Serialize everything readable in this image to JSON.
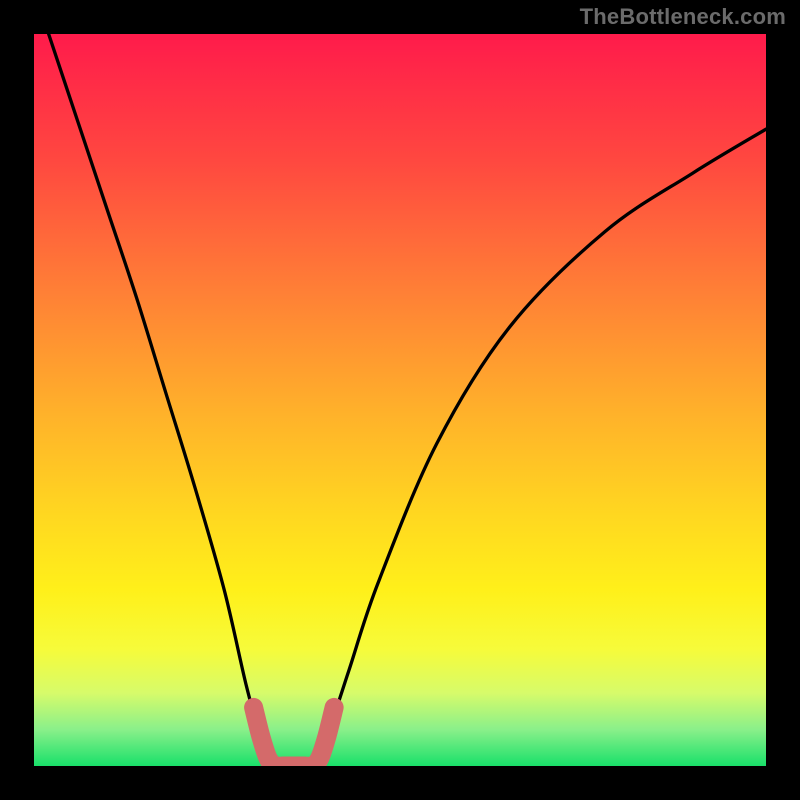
{
  "watermark": "TheBottleneck.com",
  "chart_data": {
    "type": "line",
    "title": "",
    "xlabel": "",
    "ylabel": "",
    "xlim": [
      0,
      100
    ],
    "ylim": [
      0,
      100
    ],
    "series": [
      {
        "name": "curve-left",
        "x": [
          2,
          6,
          10,
          14,
          18,
          22,
          26,
          29,
          31,
          33
        ],
        "y": [
          100,
          88,
          76,
          64,
          51,
          38,
          24,
          11,
          4,
          0
        ]
      },
      {
        "name": "curve-right",
        "x": [
          38,
          40,
          43,
          47,
          55,
          65,
          78,
          90,
          100
        ],
        "y": [
          0,
          4,
          13,
          25,
          44,
          60,
          73,
          81,
          87
        ]
      },
      {
        "name": "valley-marker",
        "x": [
          30,
          31,
          32,
          33,
          34,
          35,
          36,
          37,
          38,
          39,
          40,
          41
        ],
        "y": [
          8,
          4,
          1,
          0,
          0,
          0,
          0,
          0,
          0,
          1,
          4,
          8
        ]
      }
    ],
    "background": {
      "type": "vertical-gradient",
      "stops": [
        {
          "offset": 0.0,
          "color": "#ff1b4b"
        },
        {
          "offset": 0.17,
          "color": "#ff4740"
        },
        {
          "offset": 0.35,
          "color": "#ff7f36"
        },
        {
          "offset": 0.52,
          "color": "#ffb22a"
        },
        {
          "offset": 0.66,
          "color": "#ffd820"
        },
        {
          "offset": 0.76,
          "color": "#fff01a"
        },
        {
          "offset": 0.84,
          "color": "#f6fb3a"
        },
        {
          "offset": 0.9,
          "color": "#d7fb6a"
        },
        {
          "offset": 0.95,
          "color": "#8af08a"
        },
        {
          "offset": 1.0,
          "color": "#19e06a"
        }
      ]
    },
    "marker_color": "#d46a6a",
    "curve_color": "#000000"
  }
}
